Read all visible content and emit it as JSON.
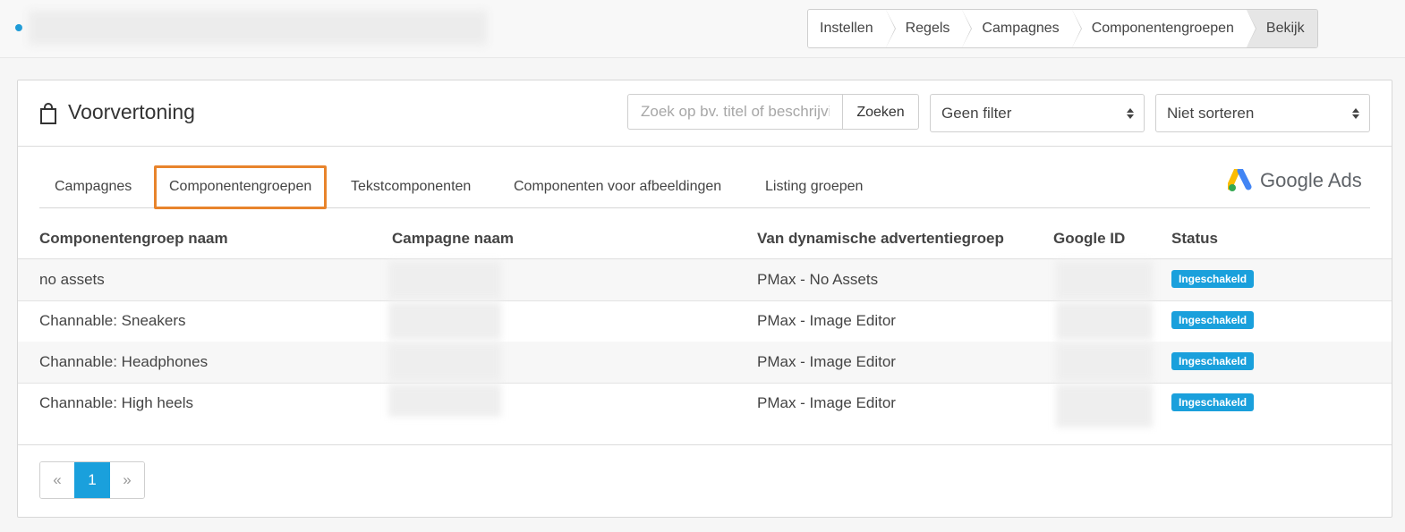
{
  "breadcrumb": [
    "Instellen",
    "Regels",
    "Campagnes",
    "Componentengroepen",
    "Bekijk"
  ],
  "panel": {
    "title": "Voorvertoning",
    "search_placeholder": "Zoek op bv. titel of beschrijving",
    "search_button": "Zoeken",
    "filter_select": "Geen filter",
    "sort_select": "Niet sorteren"
  },
  "tabs": [
    "Campagnes",
    "Componentengroepen",
    "Tekstcomponenten",
    "Componenten voor afbeeldingen",
    "Listing groepen"
  ],
  "active_tab": "Componentengroepen",
  "brand": "Google Ads",
  "table": {
    "headers": [
      "Componentengroep naam",
      "Campagne naam",
      "Van dynamische advertentiegroep",
      "Google ID",
      "Status"
    ],
    "rows": [
      {
        "name": "no assets",
        "source": "PMax - No Assets",
        "status": "Ingeschakeld"
      },
      {
        "name": "Channable: Sneakers",
        "source": "PMax - Image Editor",
        "status": "Ingeschakeld"
      },
      {
        "name": "Channable: Headphones",
        "source": "PMax - Image Editor",
        "status": "Ingeschakeld"
      },
      {
        "name": "Channable: High heels",
        "source": "PMax - Image Editor",
        "status": "Ingeschakeld"
      }
    ]
  },
  "pagination": {
    "prev": "«",
    "current": "1",
    "next": "»"
  },
  "colors": {
    "accent": "#1aa0dc",
    "active_tab_border": "#e8842c"
  }
}
